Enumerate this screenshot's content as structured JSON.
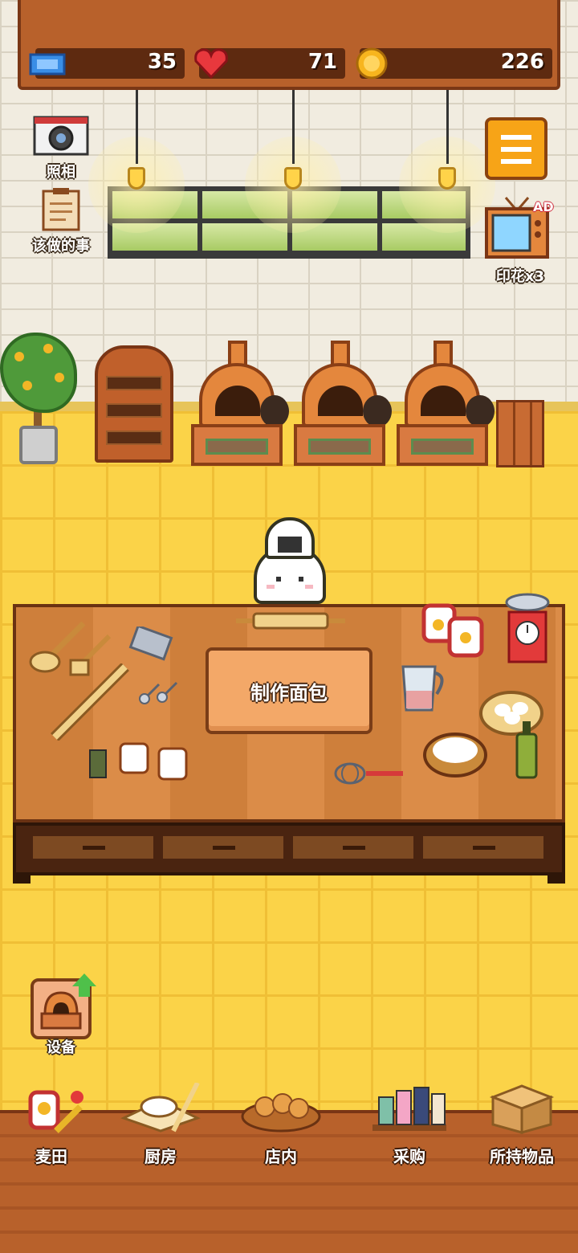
{
  "status": {
    "tickets": "35",
    "hearts": "71",
    "coins": "226"
  },
  "left_buttons": {
    "camera_label": "照相",
    "todo_label": "该做的事"
  },
  "right_buttons": {
    "ad_badge": "AD",
    "stamp_label": "印花x3"
  },
  "table": {
    "make_bread_label": "制作面包"
  },
  "equipment": {
    "label": "设备"
  },
  "nav": [
    {
      "label": "麦田",
      "icon": "wheat-field-icon"
    },
    {
      "label": "厨房",
      "icon": "kitchen-icon"
    },
    {
      "label": "店内",
      "icon": "bread-basket-icon"
    },
    {
      "label": "采购",
      "icon": "purchase-shelf-icon"
    },
    {
      "label": "所持物品",
      "icon": "cardboard-box-icon"
    }
  ],
  "colors": {
    "wall": "#f1ece0",
    "floor": "#fbd348",
    "wood": "#b8612b",
    "menu_button": "#f7a417",
    "table_top": "#d9863e"
  }
}
